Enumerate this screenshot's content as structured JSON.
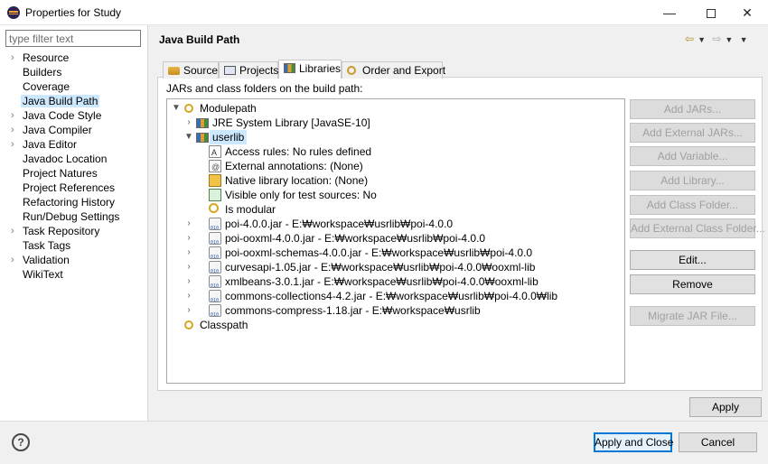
{
  "window": {
    "title": "Properties for Study",
    "minimize": "—",
    "close": "✕"
  },
  "filter": {
    "placeholder": "type filter text"
  },
  "nav": {
    "items": [
      {
        "label": "Resource",
        "expandable": true,
        "selected": false
      },
      {
        "label": "Builders",
        "expandable": false,
        "selected": false
      },
      {
        "label": "Coverage",
        "expandable": false,
        "selected": false
      },
      {
        "label": "Java Build Path",
        "expandable": false,
        "selected": true
      },
      {
        "label": "Java Code Style",
        "expandable": true,
        "selected": false
      },
      {
        "label": "Java Compiler",
        "expandable": true,
        "selected": false
      },
      {
        "label": "Java Editor",
        "expandable": true,
        "selected": false
      },
      {
        "label": "Javadoc Location",
        "expandable": false,
        "selected": false
      },
      {
        "label": "Project Natures",
        "expandable": false,
        "selected": false
      },
      {
        "label": "Project References",
        "expandable": false,
        "selected": false
      },
      {
        "label": "Refactoring History",
        "expandable": false,
        "selected": false
      },
      {
        "label": "Run/Debug Settings",
        "expandable": false,
        "selected": false
      },
      {
        "label": "Task Repository",
        "expandable": true,
        "selected": false
      },
      {
        "label": "Task Tags",
        "expandable": false,
        "selected": false
      },
      {
        "label": "Validation",
        "expandable": true,
        "selected": false
      },
      {
        "label": "WikiText",
        "expandable": false,
        "selected": false
      }
    ]
  },
  "page": {
    "heading": "Java Build Path",
    "tabs": [
      {
        "label": "Source",
        "icon": "source-folder-icon"
      },
      {
        "label": "Projects",
        "icon": "projects-icon"
      },
      {
        "label": "Libraries",
        "icon": "libraries-icon"
      },
      {
        "label": "Order and Export",
        "icon": "order-export-icon"
      }
    ],
    "active_tab": "Libraries",
    "panel_label": "JARs and class folders on the build path:"
  },
  "tree": {
    "modulepath": "Modulepath",
    "jre": "JRE System Library [JavaSE-10]",
    "userlib": "userlib",
    "userlib_details": [
      {
        "label": "Access rules: No rules defined",
        "icon": "access-rules-icon"
      },
      {
        "label": "External annotations: (None)",
        "icon": "external-annotations-icon"
      },
      {
        "label": "Native library location: (None)",
        "icon": "native-library-icon"
      },
      {
        "label": "Visible only for test sources: No",
        "icon": "test-sources-icon"
      },
      {
        "label": "Is modular",
        "icon": "modular-icon"
      }
    ],
    "jars": [
      "poi-4.0.0.jar - E:₩workspace₩usrlib₩poi-4.0.0",
      "poi-ooxml-4.0.0.jar - E:₩workspace₩usrlib₩poi-4.0.0",
      "poi-ooxml-schemas-4.0.0.jar - E:₩workspace₩usrlib₩poi-4.0.0",
      "curvesapi-1.05.jar - E:₩workspace₩usrlib₩poi-4.0.0₩ooxml-lib",
      "xmlbeans-3.0.1.jar - E:₩workspace₩usrlib₩poi-4.0.0₩ooxml-lib",
      "commons-collections4-4.2.jar - E:₩workspace₩usrlib₩poi-4.0.0₩lib",
      "commons-compress-1.18.jar - E:₩workspace₩usrlib"
    ],
    "classpath": "Classpath"
  },
  "buttons": {
    "add_jars": "Add JARs...",
    "add_external_jars": "Add External JARs...",
    "add_variable": "Add Variable...",
    "add_library": "Add Library...",
    "add_class_folder": "Add Class Folder...",
    "add_external_class_folder": "Add External Class Folder...",
    "edit": "Edit...",
    "remove": "Remove",
    "migrate_jar": "Migrate JAR File...",
    "apply": "Apply",
    "apply_and_close": "Apply and Close",
    "cancel": "Cancel"
  },
  "help": {
    "glyph": "?"
  }
}
